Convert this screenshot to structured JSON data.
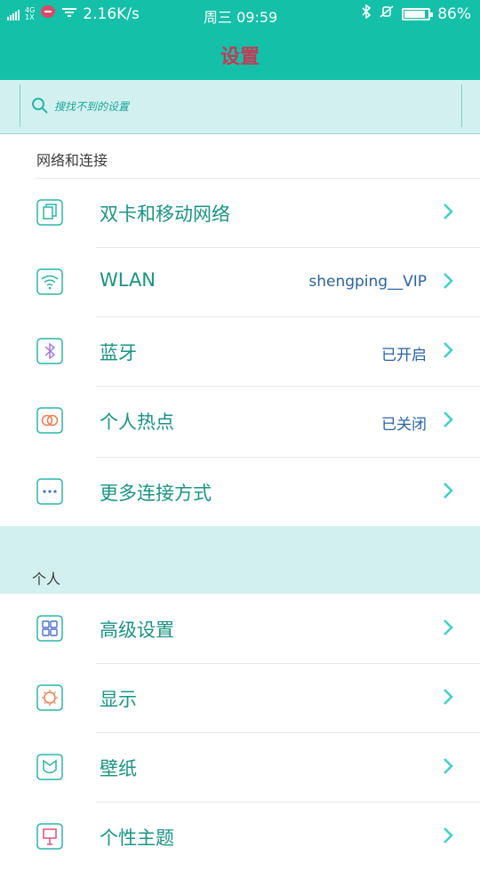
{
  "status_bar": {
    "network_type_top": "4G",
    "network_type_bottom": "1X",
    "speed": "2.16K/s",
    "day_time": "周三 09:59",
    "battery_percent": "86%",
    "battery_level": 0.86
  },
  "header": {
    "title": "设置"
  },
  "search": {
    "placeholder": "搜找不到的设置"
  },
  "sections": {
    "network": {
      "title": "网络和连接",
      "items": [
        {
          "label": "双卡和移动网络",
          "value": "",
          "icon": "dual-sim-icon"
        },
        {
          "label": "WLAN",
          "value": "shengping__VIP",
          "icon": "wifi-icon"
        },
        {
          "label": "蓝牙",
          "value": "已开启",
          "icon": "bluetooth-icon"
        },
        {
          "label": "个人热点",
          "value": "已关闭",
          "icon": "hotspot-icon"
        },
        {
          "label": "更多连接方式",
          "value": "",
          "icon": "more-icon"
        }
      ]
    },
    "personal": {
      "title": "个人",
      "items": [
        {
          "label": "高级设置",
          "value": "",
          "icon": "grid-icon"
        },
        {
          "label": "显示",
          "value": "",
          "icon": "display-icon"
        },
        {
          "label": "壁纸",
          "value": "",
          "icon": "wallpaper-icon"
        },
        {
          "label": "个性主题",
          "value": "",
          "icon": "theme-icon"
        }
      ]
    }
  },
  "colors": {
    "accent": "#14c0a8",
    "title_text": "#c43a55",
    "label_text": "#1a9485",
    "value_text": "#2a63a8",
    "section_band": "#d3f0f0"
  }
}
